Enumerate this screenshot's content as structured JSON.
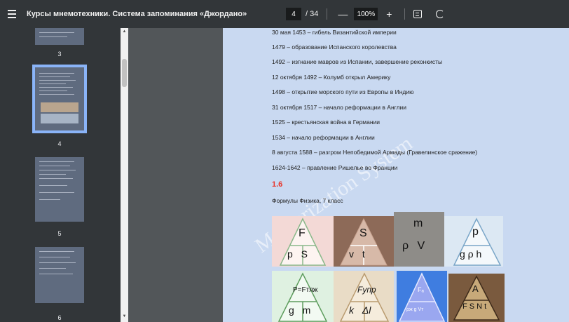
{
  "toolbar": {
    "title": "Курсы мнемотехники. Система запоминания «Джордано»",
    "current_page": "4",
    "total_pages": "/ 34",
    "zoom": "100%",
    "zoom_out_label": "—",
    "zoom_in_label": "+"
  },
  "sidebar": {
    "thumbnails": [
      {
        "label": "3"
      },
      {
        "label": "4"
      },
      {
        "label": "5"
      },
      {
        "label": "6"
      }
    ]
  },
  "page": {
    "page_number": "4",
    "lines": [
      "30 мая 1453 – гибель Византийской империи",
      "1479 – образование Испанского королевства",
      "1492 – изгнание мавров из Испании, завершение реконкисты",
      "12 октября 1492 – Колумб открыл Америку",
      "1498 – открытие морского пути из Европы в Индию",
      "31 октября 1517 – начало реформации в Англии",
      "1525 – крестьянская война в Германии",
      "1534 – начало реформации в Англии",
      "8 августа 1588 – разгром Непобедимой Армады (Гравелинское сражение)",
      "1624-1642 – правление Ришелье во Франции"
    ],
    "section": "1.6",
    "subtitle": "Формулы Физика, 7 класс",
    "watermark": "Memorization System",
    "formula_tiles_row1": [
      {
        "top": "F",
        "bottom": "p  S",
        "bg": "#f3d9d6"
      },
      {
        "top": "S",
        "bottom": "v  t",
        "bg": "#8d6a58"
      },
      {
        "top": "m",
        "bottom": "ρ  V",
        "bg": "#8e8c88"
      },
      {
        "top": "p",
        "bottom": "g ρ h",
        "bg": "#dce8f3"
      }
    ],
    "formula_tiles_row2": [
      {
        "top": "P=Fтяж",
        "bottom": "g  m",
        "bg": "#dff1e1"
      },
      {
        "top": "Fупр",
        "bottom": "k  Δl",
        "bg": "#e9dcc6"
      },
      {
        "top": "Fₐ",
        "bottom": "ρж g Vт",
        "bg": "#3f7de0"
      },
      {
        "top": "A",
        "bottom": "F  S  N  t",
        "bg": "#7a5a3e"
      }
    ]
  }
}
